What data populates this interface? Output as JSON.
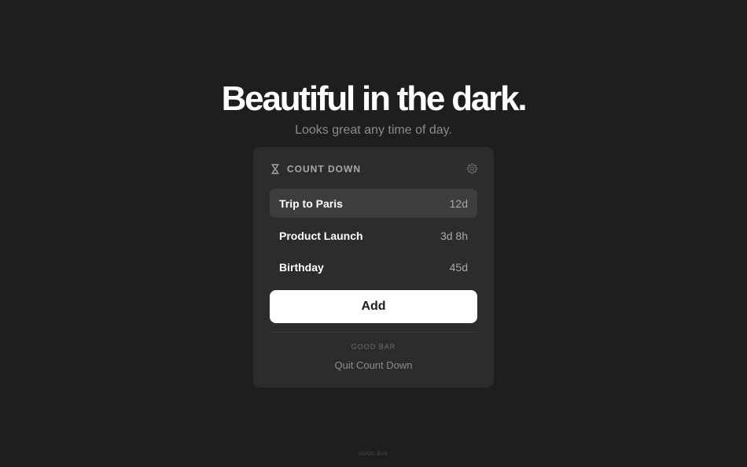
{
  "hero": {
    "title": "Beautiful in the dark.",
    "subtitle": "Looks great any time of day."
  },
  "panel": {
    "icon": "hourglass-icon",
    "title": "COUNT DOWN",
    "settings_icon": "gear-icon",
    "items": [
      {
        "name": "Trip to Paris",
        "time": "12d",
        "selected": true
      },
      {
        "name": "Product Launch",
        "time": "3d 8h",
        "selected": false
      },
      {
        "name": "Birthday",
        "time": "45d",
        "selected": false
      }
    ],
    "add_label": "Add",
    "brand_label": "GOOD BAR",
    "quit_label": "Quit Count Down"
  },
  "footer": {
    "brand": "GOOD BAR"
  },
  "colors": {
    "background": "#1e1e20",
    "panel": "#2c2c2e",
    "selected_row": "#3d3d40",
    "button": "#ffffff",
    "primary_text": "#ffffff",
    "secondary_text": "#a9a9ab"
  }
}
